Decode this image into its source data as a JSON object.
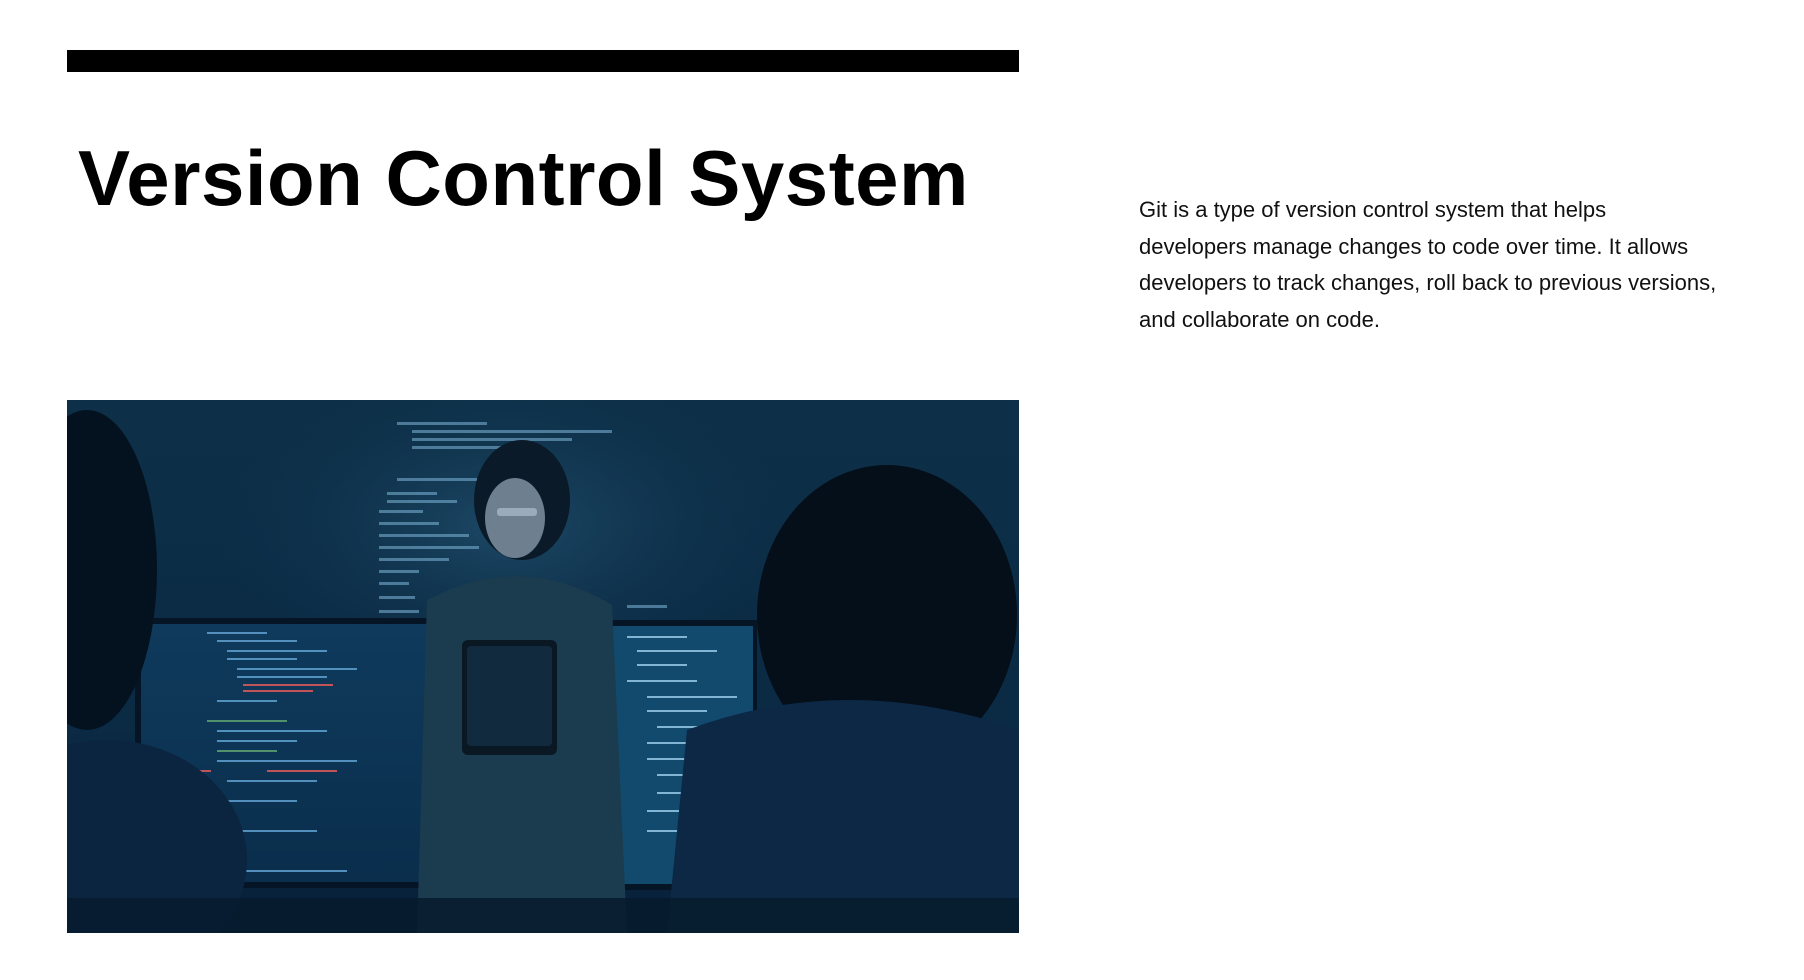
{
  "slide": {
    "title": "Version Control System",
    "body": "Git is a type of version control system that helps developers manage changes to code over time. It allows developers to track changes, roll back to previous versions, and collaborate on code."
  },
  "photo": {
    "subject": "developers-at-monitors-photo"
  },
  "colors": {
    "rule": "#000000",
    "background": "#ffffff",
    "photo_base": "#0b2a44"
  }
}
